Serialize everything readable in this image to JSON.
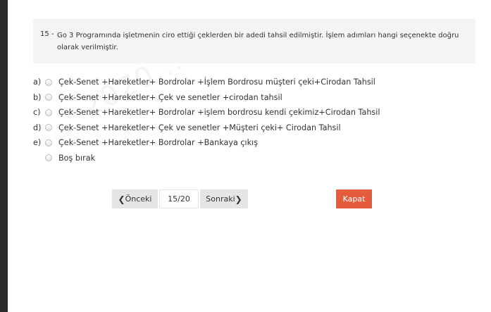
{
  "question": {
    "number": "15 -",
    "text": "Go 3 Programında işletmenin ciro ettiği çeklerden bir adedi tahsil edilmiştir. İşlem adımları hangi seçenekte doğru olarak verilmiştir."
  },
  "options": [
    {
      "letter": "a)",
      "text": "Çek-Senet +Hareketler+ Bordrolar +İşlem Bordrosu müşteri çeki+Cirodan Tahsil"
    },
    {
      "letter": "b)",
      "text": "Çek-Senet +Hareketler+ Çek ve senetler +cirodan tahsil"
    },
    {
      "letter": "c)",
      "text": "Çek-Senet +Hareketler+ Bordrolar +işlem bordrosu kendi çekimiz+Cirodan Tahsil"
    },
    {
      "letter": "d)",
      "text": "Çek-Senet +Hareketler+ Çek ve senetler +Müşteri çeki+ Cirodan Tahsil"
    },
    {
      "letter": "e)",
      "text": "Çek-Senet +Hareketler+ Bordrolar +Bankaya çıkış"
    }
  ],
  "blank_option": {
    "text": "Boş bırak"
  },
  "pagination": {
    "prev_label": "Önceki",
    "next_label": "Sonraki",
    "page": "15/20"
  },
  "close_label": "Kapat",
  "watermark": "2020...",
  "colors": {
    "close_button": "#e55b3c",
    "nav_button": "#e5e5e5",
    "question_background": "#f4f4f4"
  }
}
